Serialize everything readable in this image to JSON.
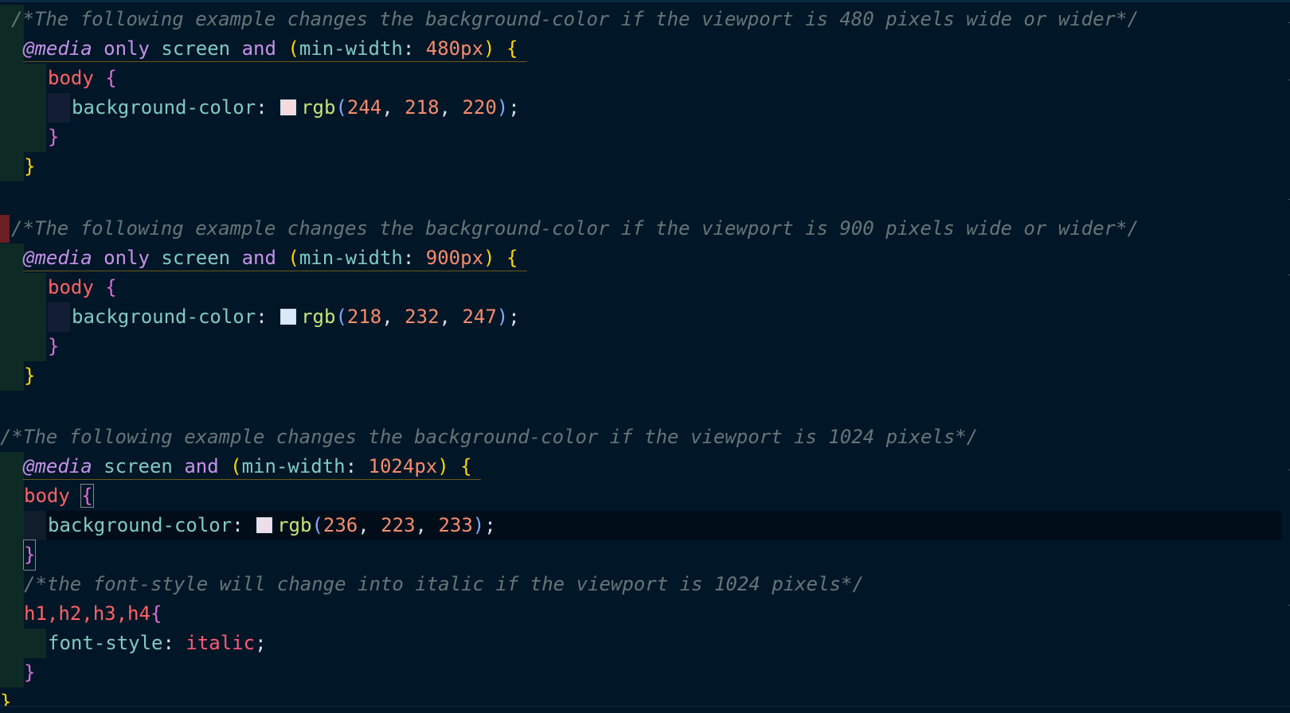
{
  "editor": {
    "language": "css",
    "lines": {
      "l1": "/*The following example changes the background-color if the viewport is 480 pixels wide or wider*/",
      "l2": {
        "at": "@media",
        "only": "only",
        "screen": "screen",
        "and": "and",
        "prop": "min-width",
        "num": "480",
        "unit": "px"
      },
      "l3": "body",
      "l4": {
        "prop": "background-color",
        "fn": "rgb",
        "r": "244",
        "g": "218",
        "b": "220"
      },
      "l7": "/*The following example changes the background-color if the viewport is 900 pixels wide or wider*/",
      "l8": {
        "at": "@media",
        "only": "only",
        "screen": "screen",
        "and": "and",
        "prop": "min-width",
        "num": "900",
        "unit": "px"
      },
      "l9": "body",
      "l10": {
        "prop": "background-color",
        "fn": "rgb",
        "r": "218",
        "g": "232",
        "b": "247"
      },
      "l13": "/*The following example changes the background-color if the viewport is 1024 pixels*/",
      "l14": {
        "at": "@media",
        "screen": "screen",
        "and": "and",
        "prop": "min-width",
        "num": "1024",
        "unit": "px"
      },
      "l15": "body",
      "l16": {
        "prop": "background-color",
        "fn": "rgb",
        "r": "236",
        "g": "223",
        "b": "233"
      },
      "l18": "/*the font-style will change into italic if the viewport is 1024 pixels*/",
      "l19": "h1,h2,h3,h4",
      "l20": {
        "prop": "font-style",
        "value": "italic"
      }
    },
    "swatches": {
      "s1": "#f4dadc",
      "s2": "#dae8f7",
      "s3": "#ecdfe9"
    },
    "colors": {
      "background": "#011627",
      "comment": "#637777",
      "keyword": "#c792ea",
      "property": "#80cbc4",
      "number": "#f78c6c",
      "selector": "#ff6363"
    }
  }
}
